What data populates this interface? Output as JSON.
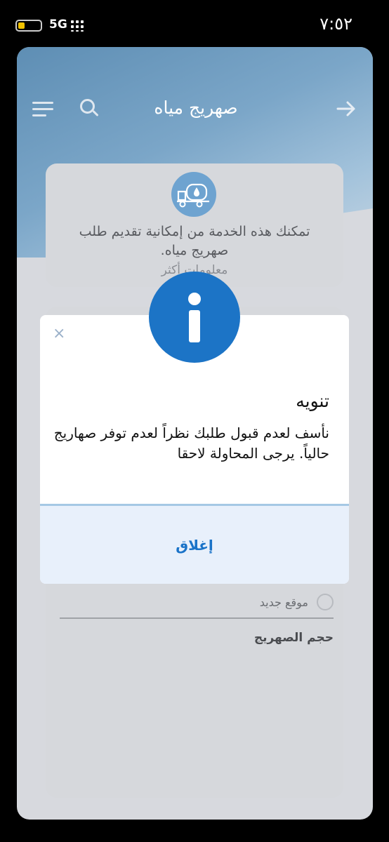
{
  "status_bar": {
    "time": "٧:٥٢",
    "network": "5G",
    "battery_level": 0.3,
    "icons": [
      "battery-icon",
      "signal-icon"
    ]
  },
  "header": {
    "title": "صهريج مياه",
    "icons": [
      "menu-icon",
      "search-icon",
      "back-arrow-icon"
    ]
  },
  "service_card": {
    "icon": "water-truck-icon",
    "description": "تمكنك هذه الخدمة من إمكانية تقديم طلب صهريج مياه.",
    "more_link": "معلومات أكثر"
  },
  "form": {
    "new_location_label": "موقع جديد",
    "tank_size_label": "حجم الصهريج"
  },
  "dialog": {
    "close_symbol": "×",
    "icon": "info-icon",
    "title": "تنويه",
    "message": "نأسف لعدم قبول طلبك نظراً لعدم توفر صهاريج حالياً. يرجى المحاولة لاحقا",
    "close_button_label": "إغلاق"
  },
  "colors": {
    "accent": "#1c74c6",
    "header_gradient_start": "#5e8eb4",
    "dialog_footer": "#e8f0fb",
    "divider": "#a5c8e4"
  }
}
